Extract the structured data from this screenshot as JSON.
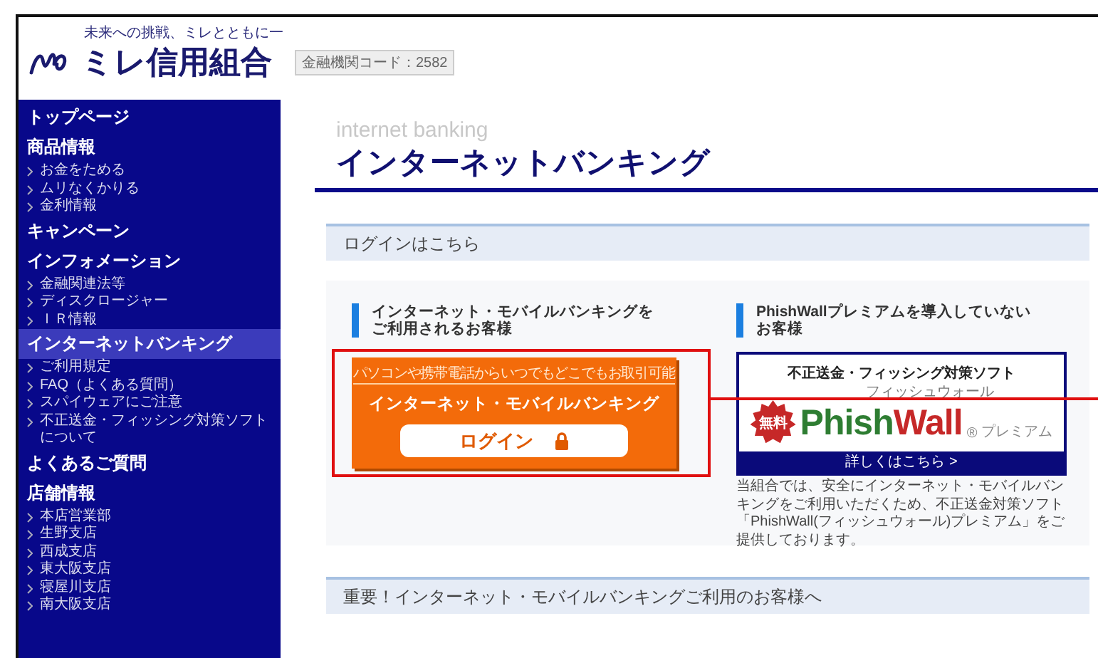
{
  "header": {
    "tagline": "未来への挑戦、ミレとともに一",
    "logo": "ミレ信用組合",
    "bank_code": "金融機関コード：2582"
  },
  "sidebar": {
    "items": [
      {
        "label": "トップページ",
        "selected": false
      },
      {
        "label": "商品情報",
        "selected": false,
        "children": [
          {
            "label": "お金をためる"
          },
          {
            "label": "ムリなくかりる"
          },
          {
            "label": "金利情報"
          }
        ]
      },
      {
        "label": "キャンペーン",
        "selected": false
      },
      {
        "label": "インフォメーション",
        "selected": false,
        "children": [
          {
            "label": "金融関連法等"
          },
          {
            "label": "ディスクロージャー"
          },
          {
            "label": "ＩＲ情報"
          }
        ]
      },
      {
        "label": "インターネットバンキング",
        "selected": true,
        "children": [
          {
            "label": "ご利用規定"
          },
          {
            "label": "FAQ（よくある質問）"
          },
          {
            "label": "スパイウェアにご注意"
          },
          {
            "label": "不正送金・フィッシング対策ソフトについて"
          }
        ]
      },
      {
        "label": "よくあるご質問",
        "selected": false
      },
      {
        "label": "店舗情報",
        "selected": false,
        "children": [
          {
            "label": "本店営業部"
          },
          {
            "label": "生野支店"
          },
          {
            "label": "西成支店"
          },
          {
            "label": "東大阪支店"
          },
          {
            "label": "寝屋川支店"
          },
          {
            "label": "南大阪支店"
          }
        ]
      }
    ]
  },
  "page": {
    "subtitle": "internet banking",
    "title": "インターネットバンキング"
  },
  "login_section": {
    "heading": "ログインはこちら",
    "left": {
      "heading_lines": [
        "インターネット・モバイルバンキングを",
        "ご利用されるお客様"
      ],
      "banner": {
        "caption": "パソコンや携帯電話からいつでもどこでもお取引可能",
        "title": "インターネット・モバイルバンキング",
        "button": "ログイン"
      }
    },
    "right": {
      "heading_lines": [
        "PhishWallプレミアムを導入していない",
        "お客様"
      ],
      "ad": {
        "caption": "不正送金・フィッシング対策ソフト",
        "ruby": "フィッシュウォール",
        "badge": "無料",
        "brand_first": "Phish",
        "brand_second": "Wall",
        "mark": "®",
        "suffix": "プレミアム",
        "link": "詳しくはこちら >"
      },
      "description": "当組合では、安全にインターネット・モバイルバンキングをご利用いただくため、不正送金対策ソフト「PhishWall(フィッシュウォール)プレミアム」をご提供しております。"
    }
  },
  "notice_section": {
    "heading": "重要！インターネット・モバイルバンキングご利用のお客様へ"
  }
}
